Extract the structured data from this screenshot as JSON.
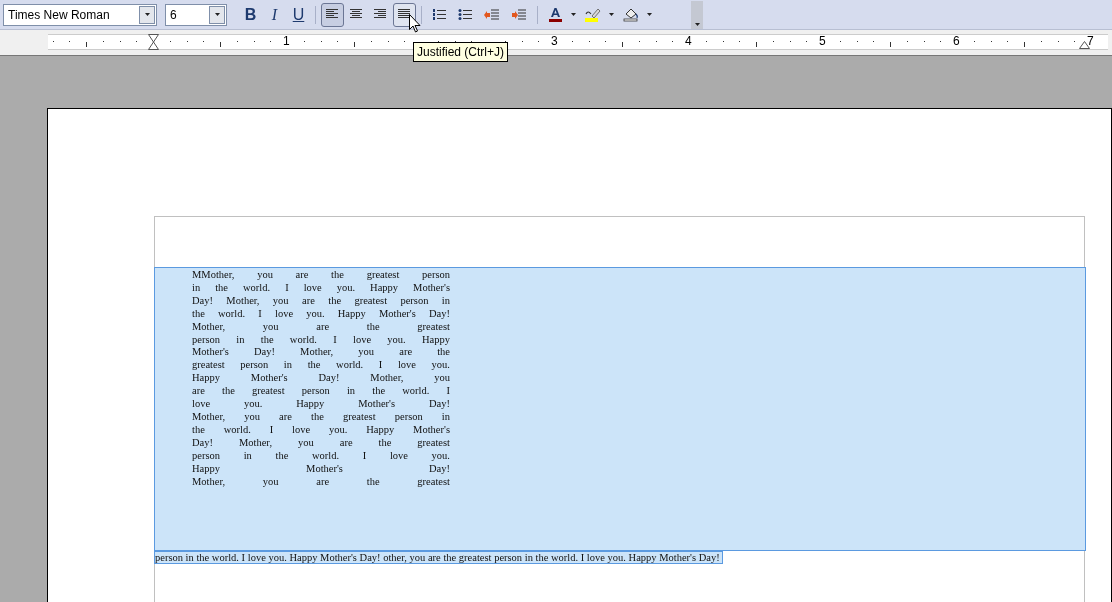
{
  "toolbar": {
    "font_name": "Times New Roman",
    "font_size": "6",
    "buttons": [
      {
        "kind": "bold",
        "label": "B",
        "selected": false
      },
      {
        "kind": "italic",
        "label": "I",
        "selected": false
      },
      {
        "kind": "underline",
        "label": "U",
        "selected": false
      },
      {
        "kind": "sep"
      },
      {
        "kind": "align-left",
        "selected": true
      },
      {
        "kind": "align-center",
        "selected": false
      },
      {
        "kind": "align-right",
        "selected": false
      },
      {
        "kind": "align-justify",
        "selected": false,
        "hovered": true
      },
      {
        "kind": "sep"
      },
      {
        "kind": "numbering",
        "selected": false
      },
      {
        "kind": "bullets",
        "selected": false
      },
      {
        "kind": "outdent",
        "selected": false
      },
      {
        "kind": "indent",
        "selected": false
      },
      {
        "kind": "sep"
      },
      {
        "kind": "font-color",
        "selected": false
      },
      {
        "kind": "highlight",
        "selected": false
      },
      {
        "kind": "background",
        "selected": false
      }
    ]
  },
  "tooltip": "Justified (Ctrl+J)",
  "ruler": {
    "labels": [
      "1",
      "3",
      "4",
      "5",
      "6",
      "7"
    ]
  },
  "document": {
    "selected_lines": [
      "MMother, you are the greatest person",
      "in the world. I love you. Happy Mother's",
      "Day! Mother, you are the greatest person in",
      "the world. I love you. Happy Mother's Day!",
      "Mother, you are the greatest",
      "person in the world. I love you. Happy",
      "Mother's Day! Mother, you are the",
      "greatest person in the world. I love you.",
      "Happy Mother's Day! Mother, you",
      "are the greatest person in the world. I",
      "love you. Happy Mother's Day!",
      "Mother, you are the greatest person in",
      "the world. I love you. Happy Mother's",
      "Day! Mother, you are the greatest",
      "person in the world. I love you.",
      "Happy Mother's Day!",
      "Mother, you are the greatest"
    ],
    "last_line": "person in the world. I love you. Happy Mother's Day! other, you are the greatest person in the world. I love you. Happy Mother's Day!"
  }
}
